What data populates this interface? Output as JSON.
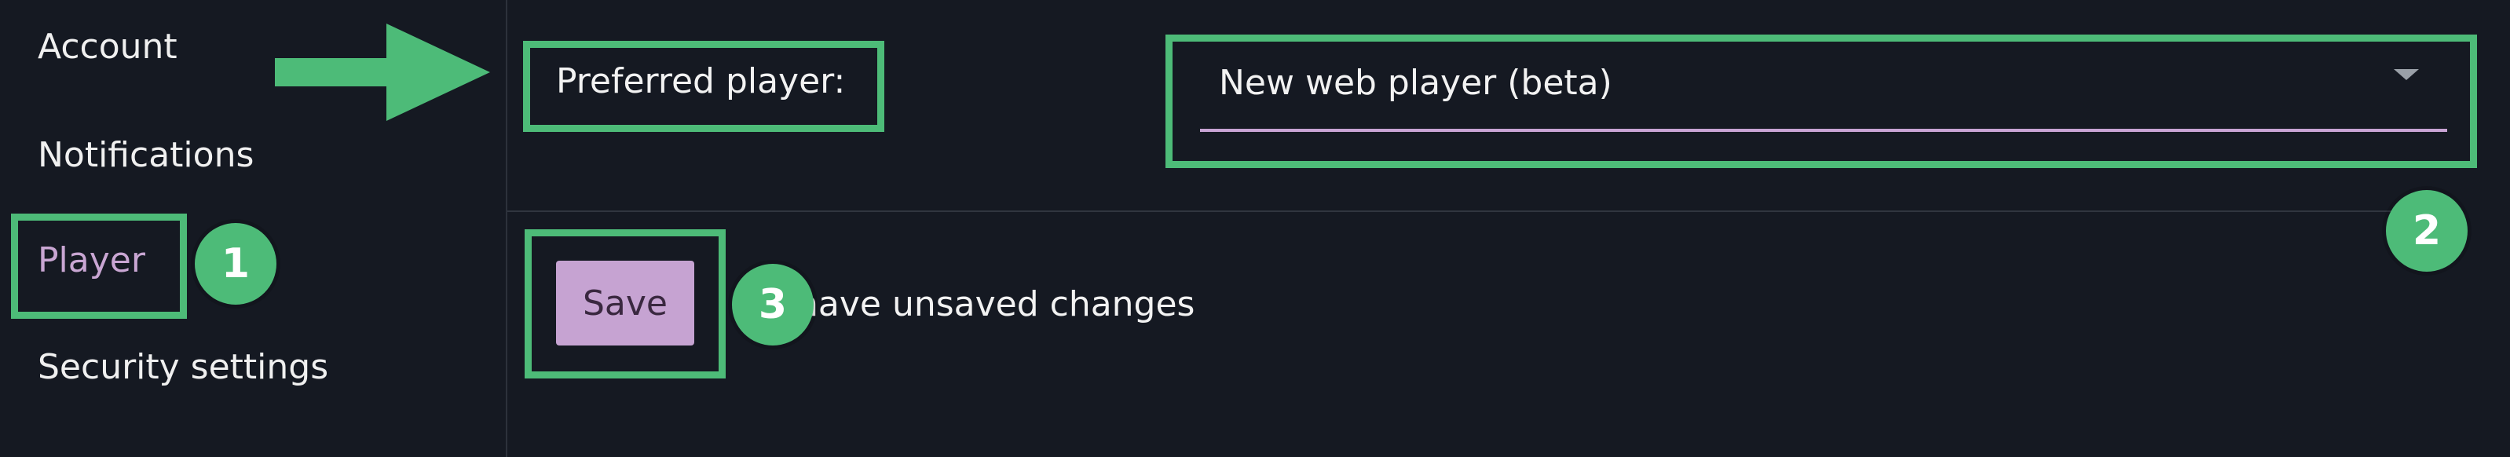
{
  "sidebar": {
    "items": [
      {
        "label": "Account"
      },
      {
        "label": "Notifications"
      },
      {
        "label": "Player",
        "active": true
      },
      {
        "label": "Security settings"
      }
    ]
  },
  "settings": {
    "preferred_player_label": "Preferred player:",
    "preferred_player_value": "New web player (beta)"
  },
  "footer": {
    "save_label": "Save",
    "unsaved_text": "have unsaved changes"
  },
  "annotations": {
    "badges": [
      "1",
      "2",
      "3"
    ],
    "highlight_color": "#4dbb78",
    "arrow_icon": "arrow-right-icon"
  },
  "colors": {
    "background": "#151922",
    "accent": "#c6a3d2",
    "highlight": "#4dbb78"
  }
}
